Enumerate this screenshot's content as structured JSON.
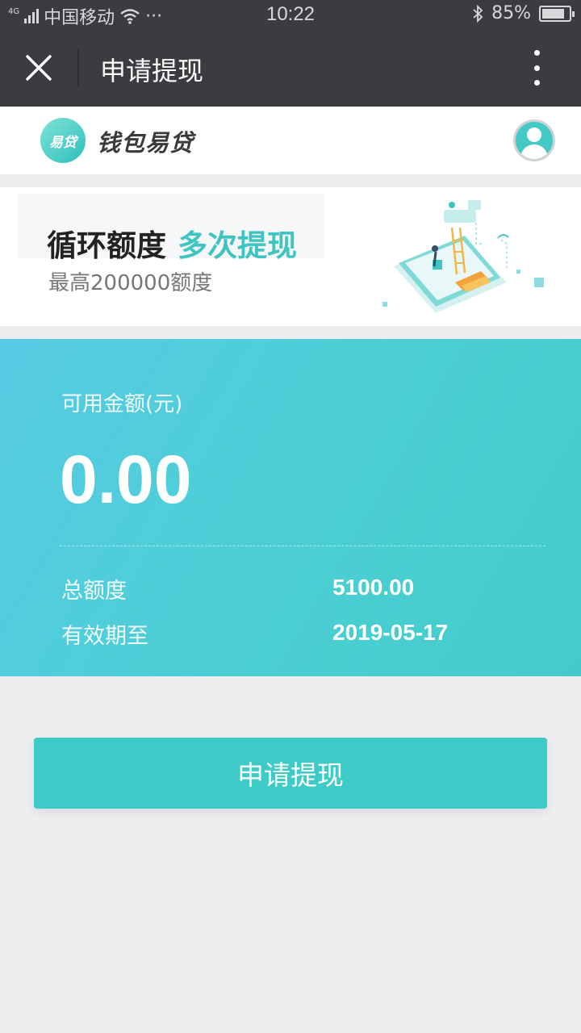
{
  "status_bar": {
    "network_tag": "4G",
    "carrier": "中国移动",
    "more": "···",
    "time": "10:22",
    "battery": "85%",
    "battery_level": 0.85
  },
  "nav": {
    "title": "申请提现"
  },
  "brand": {
    "logo_text": "易贷",
    "name": "钱包易贷"
  },
  "banner": {
    "title_part1": "循环额度",
    "title_part2": "多次提现",
    "subtitle": "最高200000额度"
  },
  "card": {
    "available_label": "可用金额(元)",
    "available_amount": "0.00",
    "total_label": "总额度",
    "total_value": "5100.00",
    "valid_label": "有效期至",
    "valid_value": "2019-05-17"
  },
  "actions": {
    "apply_label": "申请提现"
  },
  "colors": {
    "accent": "#3ecac6",
    "topbar": "#3b3c40",
    "card_gradient_start": "#57cbe4",
    "card_gradient_end": "#43cbc9"
  }
}
